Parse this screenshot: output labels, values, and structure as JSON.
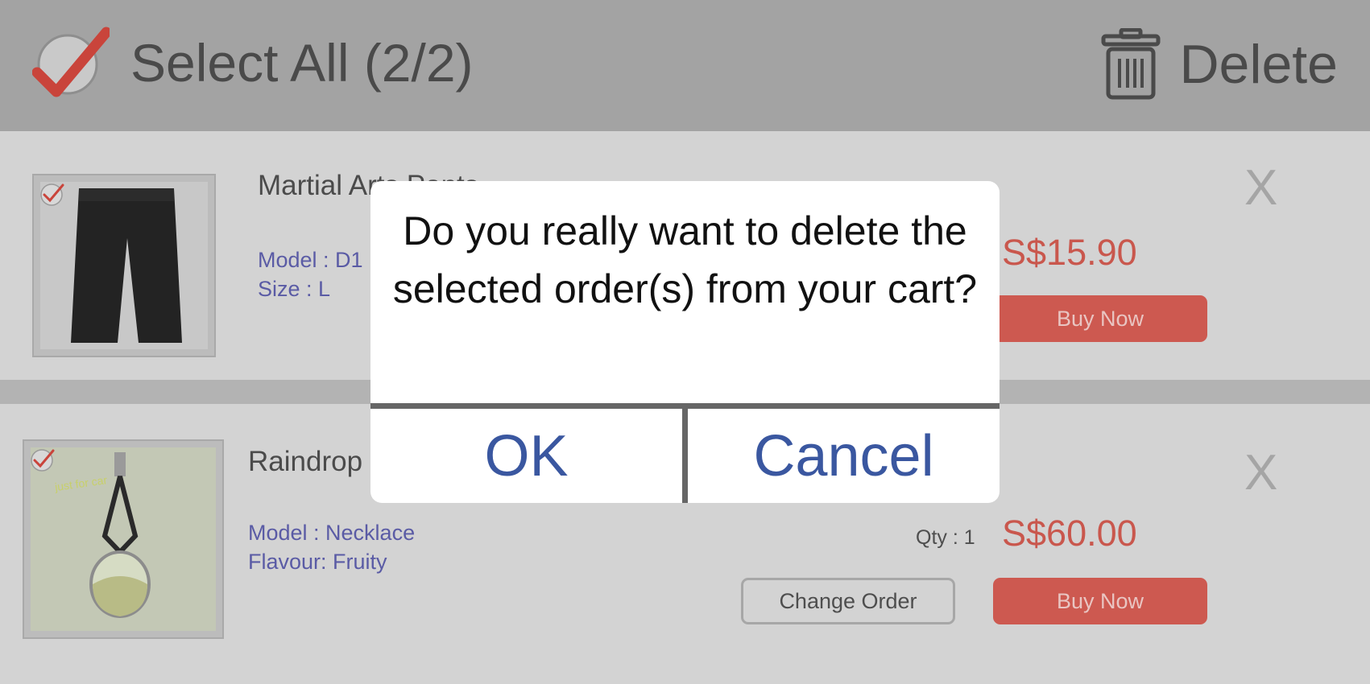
{
  "header": {
    "select_all_label": "Select All (2/2)",
    "delete_label": "Delete"
  },
  "items": [
    {
      "title": "Martial Arts Pants",
      "attributes": [
        "Model : D1",
        "Size : L"
      ],
      "price": "S$15.90",
      "buy_label": "Buy Now",
      "remove_label": "X"
    },
    {
      "title": "Raindrop",
      "attributes": [
        "Model : Necklace",
        "Flavour: Fruity"
      ],
      "qty": "Qty : 1",
      "price": "S$60.00",
      "change_label": "Change Order",
      "buy_label": "Buy Now",
      "remove_label": "X",
      "image_text": "just for car"
    }
  ],
  "dialog": {
    "message": "Do you really want to delete the selected order(s) from your cart?",
    "ok_label": "OK",
    "cancel_label": "Cancel"
  },
  "colors": {
    "accent_red": "#cd5950",
    "dialog_button_blue": "#3a57a0",
    "attribute_blue": "#5a5ba5"
  }
}
